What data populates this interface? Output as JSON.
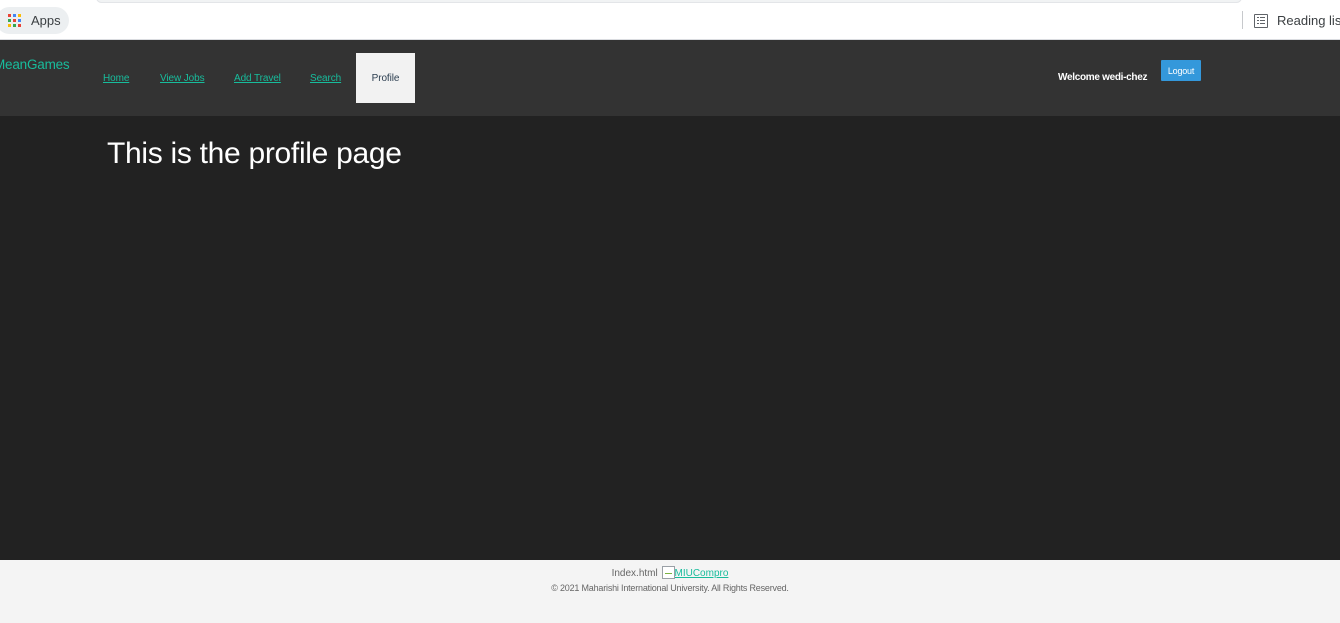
{
  "browser": {
    "bookmarks": {
      "apps_label": "Apps",
      "reading_list_label": "Reading list"
    },
    "apps_icon_colors": [
      "#ea4335",
      "#4285f4",
      "#fbbc05",
      "#34a853",
      "#ea4335",
      "#4285f4",
      "#fbbc05",
      "#34a853",
      "#ea4335"
    ]
  },
  "navbar": {
    "brand": "MeanGames",
    "links": {
      "home": "Home",
      "view_jobs": "View Jobs",
      "add_travel": "Add Travel",
      "search": "Search",
      "profile": "Profile"
    },
    "active_link": "Profile",
    "welcome_text": "Welcome wedi-chez",
    "logout_label": "Logout"
  },
  "main": {
    "heading": "This is the profile page"
  },
  "footer": {
    "index_text": "Index.html",
    "image_alt": "MIUCompro",
    "copyright": "© 2021 Maharishi International University. All Rights Reserved."
  },
  "colors": {
    "accent": "#18bc9c",
    "navbar_bg": "#333333",
    "page_bg": "#222222",
    "logout_bg": "#3498db",
    "footer_bg": "#f4f4f4"
  }
}
